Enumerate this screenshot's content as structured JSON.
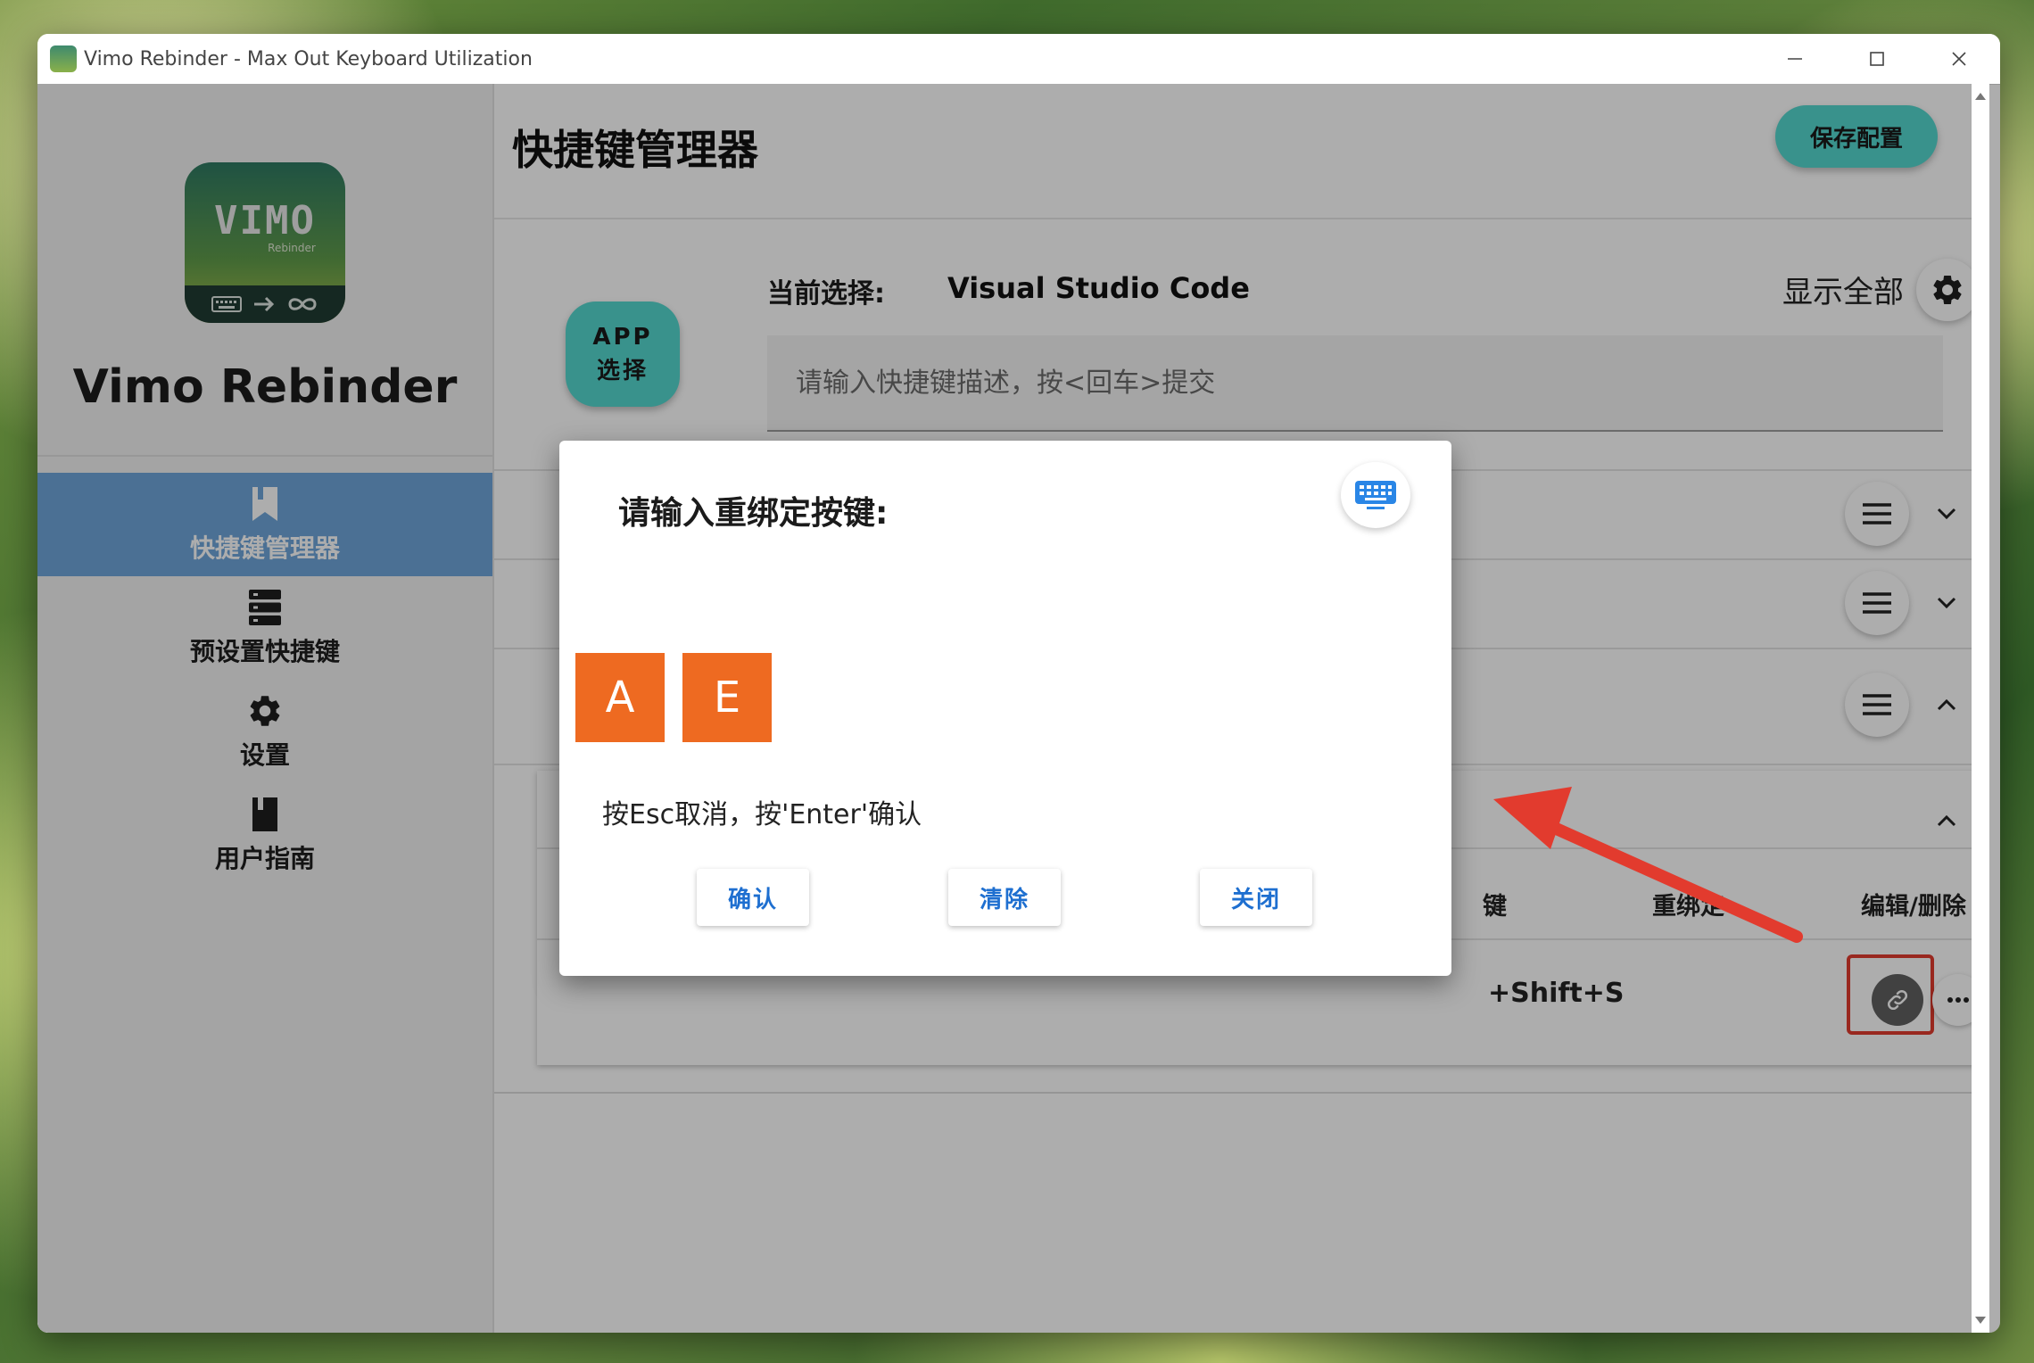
{
  "window": {
    "title": "Vimo Rebinder - Max Out Keyboard Utilization"
  },
  "sidebar": {
    "logo_word": "VIMO",
    "logo_sub": "Rebinder",
    "brand": "Vimo Rebinder",
    "items": [
      {
        "label": "快捷键管理器",
        "icon": "bookmark-icon",
        "active": true
      },
      {
        "label": "预设置快捷键",
        "icon": "server-list-icon",
        "active": false
      },
      {
        "label": "设置",
        "icon": "gear-icon",
        "active": false
      },
      {
        "label": "用户指南",
        "icon": "book-icon",
        "active": false
      }
    ]
  },
  "main": {
    "title": "快捷键管理器",
    "save_label": "保存配置",
    "app_button": {
      "line1": "APP",
      "line2": "选择"
    },
    "current_label": "当前选择:",
    "current_value": "Visual Studio Code",
    "show_all": "显示全部",
    "search_placeholder": "请输入快捷键描述，按<回车>提交",
    "table": {
      "headers": {
        "key": "键",
        "rebind": "重绑定",
        "edit": "编辑/删除"
      },
      "row_shortcut": "+Shift+S"
    }
  },
  "dialog": {
    "title": "请输入重绑定按键:",
    "keys": [
      "A",
      "E"
    ],
    "hint": "按Esc取消，按'Enter'确认",
    "confirm": "确认",
    "clear": "清除",
    "close": "关闭"
  },
  "colors": {
    "accent_teal": "#55d7cf",
    "nav_active": "#6fa6da",
    "key_chip": "#ee6a21",
    "dialog_button_text": "#1e6fd0",
    "annotation_red": "#e23b2e"
  }
}
